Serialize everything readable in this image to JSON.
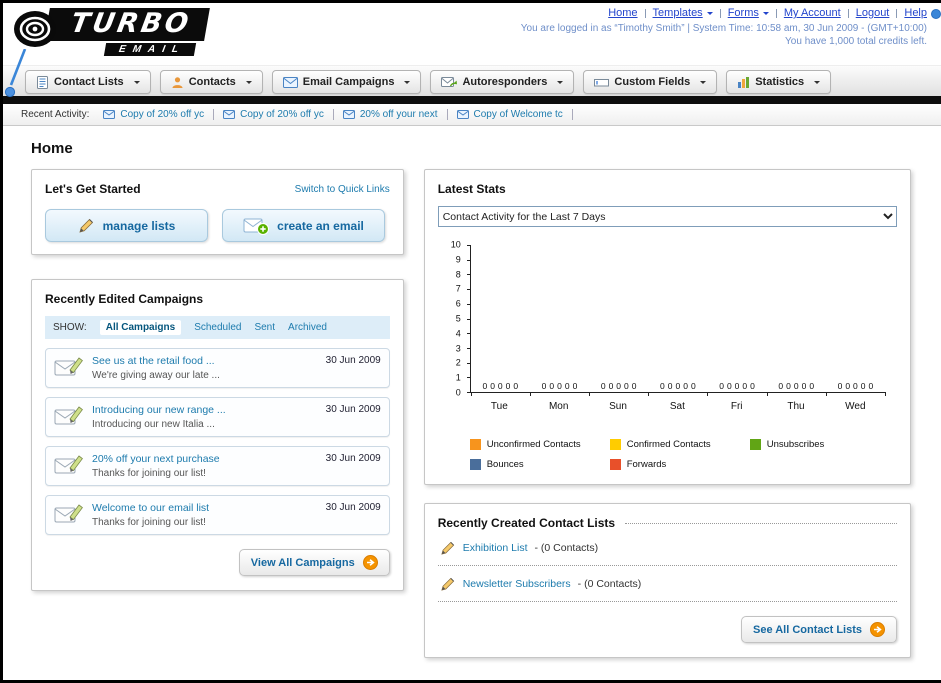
{
  "header": {
    "logo": {
      "title": "TURBO",
      "subtitle": "EMAIL"
    },
    "nav": [
      "Home",
      "Templates",
      "Forms",
      "My Account",
      "Logout",
      "Help"
    ],
    "login_info": "You are logged in as “Timothy Smith” | System Time: 10:58 am, 30 Jun 2009 - (GMT+10:00)",
    "credits_info": "You have 1,000 total credits left."
  },
  "tabs": [
    {
      "label": "Contact Lists",
      "icon": "contact-lists-icon"
    },
    {
      "label": "Contacts",
      "icon": "contacts-icon"
    },
    {
      "label": "Email Campaigns",
      "icon": "email-campaigns-icon"
    },
    {
      "label": "Autoresponders",
      "icon": "autoresponders-icon"
    },
    {
      "label": "Custom Fields",
      "icon": "custom-fields-icon"
    },
    {
      "label": "Statistics",
      "icon": "statistics-icon"
    }
  ],
  "recent_activity": {
    "label": "Recent Activity:",
    "items": [
      "Copy of 20% off yc",
      "Copy of 20% off yc",
      "20% off your next",
      "Copy of Welcome tc"
    ]
  },
  "page": {
    "title": "Home"
  },
  "get_started": {
    "title": "Let's Get Started",
    "switch_link": "Switch to Quick Links",
    "manage_lists_label": "manage lists",
    "create_email_label": "create an email"
  },
  "campaigns": {
    "title": "Recently Edited Campaigns",
    "show_label": "SHOW:",
    "filters": [
      "All Campaigns",
      "Scheduled",
      "Sent",
      "Archived"
    ],
    "active_filter": "All Campaigns",
    "items": [
      {
        "title": "See us at the retail food ...",
        "subtitle": "We're giving away our late ...",
        "date": "30 Jun 2009"
      },
      {
        "title": "Introducing our new range ...",
        "subtitle": "Introducing our new Italia ...",
        "date": "30 Jun 2009"
      },
      {
        "title": "20% off your next purchase",
        "subtitle": "Thanks for joining our list!",
        "date": "30 Jun 2009"
      },
      {
        "title": "Welcome to our email list",
        "subtitle": "Thanks for joining our list!",
        "date": "30 Jun 2009"
      }
    ],
    "view_all_label": "View All Campaigns"
  },
  "stats": {
    "title": "Latest Stats",
    "dropdown_value": "Contact Activity for the Last 7 Days",
    "chart_data": {
      "type": "bar",
      "title": "Contact Activity for the Last 7 Days",
      "categories": [
        "Tue",
        "Mon",
        "Sun",
        "Sat",
        "Fri",
        "Thu",
        "Wed"
      ],
      "series": [
        {
          "name": "Unconfirmed Contacts",
          "color": "#f7941d",
          "values": [
            0,
            0,
            0,
            0,
            0,
            0,
            0
          ]
        },
        {
          "name": "Confirmed Contacts",
          "color": "#ffcc00",
          "values": [
            0,
            0,
            0,
            0,
            0,
            0,
            0
          ]
        },
        {
          "name": "Unsubscribes",
          "color": "#61a515",
          "values": [
            0,
            0,
            0,
            0,
            0,
            0,
            0
          ]
        },
        {
          "name": "Bounces",
          "color": "#4a6e9b",
          "values": [
            0,
            0,
            0,
            0,
            0,
            0,
            0
          ]
        },
        {
          "name": "Forwards",
          "color": "#e8502a",
          "values": [
            0,
            0,
            0,
            0,
            0,
            0,
            0
          ]
        }
      ],
      "ylim": [
        0,
        10
      ],
      "grid": false,
      "legend_position": "bottom",
      "show_value_labels": true
    }
  },
  "contact_lists": {
    "title": "Recently Created Contact Lists",
    "items": [
      {
        "name": "Exhibition List",
        "detail": "- (0 Contacts)"
      },
      {
        "name": "Newsletter Subscribers",
        "detail": "- (0 Contacts)"
      }
    ],
    "see_all_label": "See All Contact Lists"
  }
}
